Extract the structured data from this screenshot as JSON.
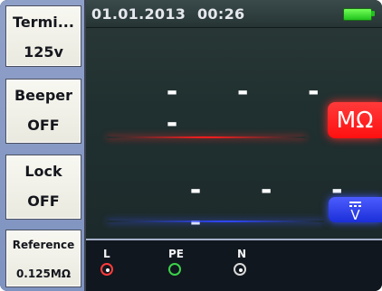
{
  "sidebar": {
    "softkeys": [
      {
        "line1": "Termi...",
        "line2": "125v"
      },
      {
        "line1": "Beeper",
        "line2": "OFF"
      },
      {
        "line1": "Lock",
        "line2": "OFF"
      },
      {
        "line1": "Reference",
        "line2": "0.125MΩ"
      }
    ]
  },
  "status": {
    "date": "01.01.2013",
    "time": "00:26",
    "battery_level": 1.0
  },
  "readings": {
    "primary": "- - - -",
    "secondary": "- - - -"
  },
  "units": {
    "resistance": "MΩ",
    "voltage": "V"
  },
  "terminals": [
    {
      "label": "L",
      "color": "#ff3b3b"
    },
    {
      "label": "PE",
      "color": "#3bd14a"
    },
    {
      "label": "N",
      "color": "#ffffff"
    }
  ],
  "colors": {
    "sidebar": "#8fa0c8",
    "screen": "#203030",
    "unit_accent": "#ff1d1d",
    "voltage_accent": "#2f47ff",
    "battery": "#22c11d"
  }
}
